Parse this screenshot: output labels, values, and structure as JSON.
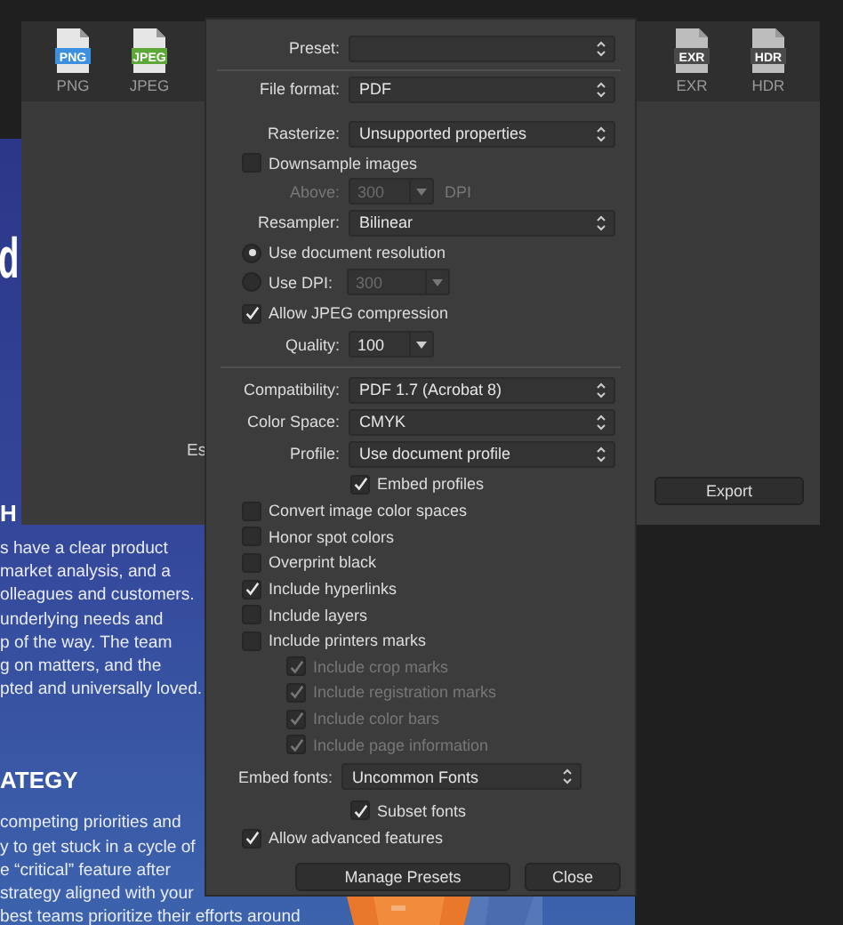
{
  "document": {
    "big_letter": "d",
    "heading_1": "H",
    "paragraph_1": [
      "s have a clear product",
      "market analysis, and a",
      "olleagues and customers.",
      "underlying needs and",
      "p of the way. The team",
      "g on matters, and the",
      "pted and universally loved."
    ],
    "heading_2": "ATEGY",
    "paragraph_2": [
      "competing priorities and",
      "y to get stuck in a cycle of",
      "e “critical” feature after",
      "strategy aligned with your",
      "best teams prioritize their efforts around"
    ]
  },
  "export_window": {
    "formats_left": [
      {
        "badge": "PNG",
        "label": "PNG",
        "color": "#3d8fe0"
      },
      {
        "badge": "JPEG",
        "label": "JPEG",
        "color": "#5ea83a"
      }
    ],
    "formats_right": [
      {
        "badge": "EXR",
        "label": "EXR",
        "color": "#4a4a4a"
      },
      {
        "badge": "HDR",
        "label": "HDR",
        "color": "#4a4a4a"
      }
    ],
    "partial_label": "Es",
    "export_button": "Export"
  },
  "panel": {
    "rows": [
      {
        "kind": "select",
        "label": "Preset:"
      },
      {
        "kind": "separator"
      },
      {
        "kind": "select",
        "label": "File format:",
        "value": "PDF"
      },
      {
        "kind": "select",
        "label": "Rasterize:",
        "value": "Unsupported properties"
      },
      {
        "kind": "checkbox",
        "label": "Downsample images",
        "checked": false
      },
      {
        "kind": "combo",
        "label": "Above:",
        "value": "300",
        "unit": "DPI",
        "disabled": true
      },
      {
        "kind": "select",
        "label": "Resampler:",
        "value": "Bilinear"
      },
      {
        "kind": "radio",
        "label": "Use document resolution",
        "selected": true
      },
      {
        "kind": "radio",
        "label": "Use DPI:",
        "selected": false,
        "value": "300",
        "disabled": true
      },
      {
        "kind": "checkbox",
        "label": "Allow JPEG compression",
        "checked": true
      },
      {
        "kind": "combo",
        "label": "Quality:",
        "value": "100",
        "disabled": false
      },
      {
        "kind": "separator"
      },
      {
        "kind": "select",
        "label": "Compatibility:",
        "value": "PDF 1.7 (Acrobat 8)"
      },
      {
        "kind": "select",
        "label": "Color Space:",
        "value": "CMYK"
      },
      {
        "kind": "select",
        "label": "Profile:",
        "value": "Use document profile"
      },
      {
        "kind": "subcheck",
        "label": "Embed profiles",
        "checked": true
      },
      {
        "kind": "checkbox",
        "label": "Convert image color spaces",
        "checked": false
      },
      {
        "kind": "checkbox",
        "label": "Honor spot colors",
        "checked": false
      },
      {
        "kind": "checkbox",
        "label": "Overprint black",
        "checked": false
      },
      {
        "kind": "checkbox",
        "label": "Include hyperlinks",
        "checked": true
      },
      {
        "kind": "checkbox",
        "label": "Include layers",
        "checked": false
      },
      {
        "kind": "checkbox",
        "label": "Include printers marks",
        "checked": false,
        "children": [
          {
            "label": "Include crop marks",
            "checked": true,
            "disabled": true
          },
          {
            "label": "Include registration marks",
            "checked": true,
            "disabled": true
          },
          {
            "label": "Include color bars",
            "checked": true,
            "disabled": true
          },
          {
            "label": "Include page information",
            "checked": true,
            "disabled": true
          }
        ]
      },
      {
        "kind": "inline",
        "label": "Embed fonts:",
        "value": "Uncommon Fonts"
      },
      {
        "kind": "subcheck",
        "label": "Subset fonts",
        "checked": true
      },
      {
        "kind": "checkbox",
        "label": "Allow advanced features",
        "checked": true
      }
    ],
    "buttons": [
      "Manage Presets",
      "Close"
    ]
  }
}
